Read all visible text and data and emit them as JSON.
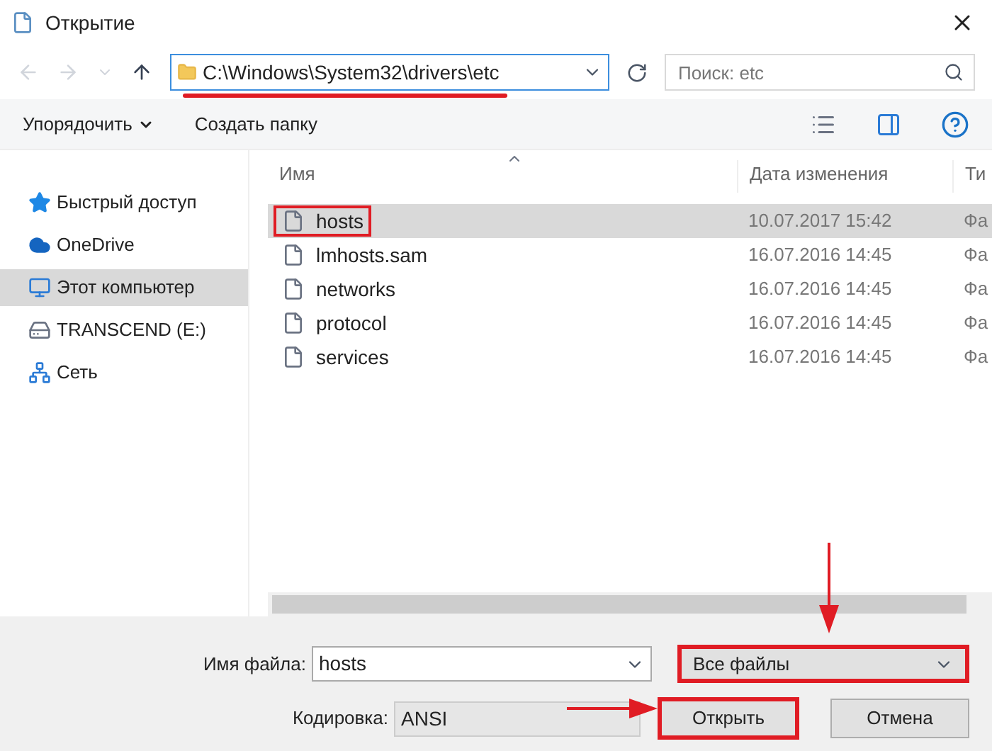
{
  "window": {
    "title": "Открытие"
  },
  "address": {
    "value": "C:\\Windows\\System32\\drivers\\etc",
    "marked": true
  },
  "search": {
    "placeholder": "Поиск: etc"
  },
  "toolbar": {
    "organize": "Упорядочить",
    "new_folder": "Создать папку"
  },
  "sidebar": {
    "items": [
      {
        "label": "Быстрый доступ",
        "kind": "star",
        "selected": false
      },
      {
        "label": "OneDrive",
        "kind": "cloud",
        "selected": false
      },
      {
        "label": "Этот компьютер",
        "kind": "computer",
        "selected": true
      },
      {
        "label": "TRANSCEND (E:)",
        "kind": "drive",
        "selected": false
      },
      {
        "label": "Сеть",
        "kind": "network",
        "selected": false
      }
    ]
  },
  "table": {
    "columns": [
      "Имя",
      "Дата изменения",
      "Ти"
    ],
    "rows": [
      {
        "name": "hosts",
        "date": "10.07.2017 15:42",
        "type": "Фа",
        "selected": true,
        "marked": true
      },
      {
        "name": "lmhosts.sam",
        "date": "16.07.2016 14:45",
        "type": "Фа",
        "selected": false,
        "marked": false
      },
      {
        "name": "networks",
        "date": "16.07.2016 14:45",
        "type": "Фа",
        "selected": false,
        "marked": false
      },
      {
        "name": "protocol",
        "date": "16.07.2016 14:45",
        "type": "Фа",
        "selected": false,
        "marked": false
      },
      {
        "name": "services",
        "date": "16.07.2016 14:45",
        "type": "Фа",
        "selected": false,
        "marked": false
      }
    ]
  },
  "footer": {
    "filename_label": "Имя файла:",
    "filename": "hosts",
    "filetype": "Все файлы",
    "filetype_marked": true,
    "encoding_label": "Кодировка:",
    "encoding": "ANSI",
    "open_button": "Открыть",
    "open_marked": true,
    "cancel_button": "Отмена"
  }
}
